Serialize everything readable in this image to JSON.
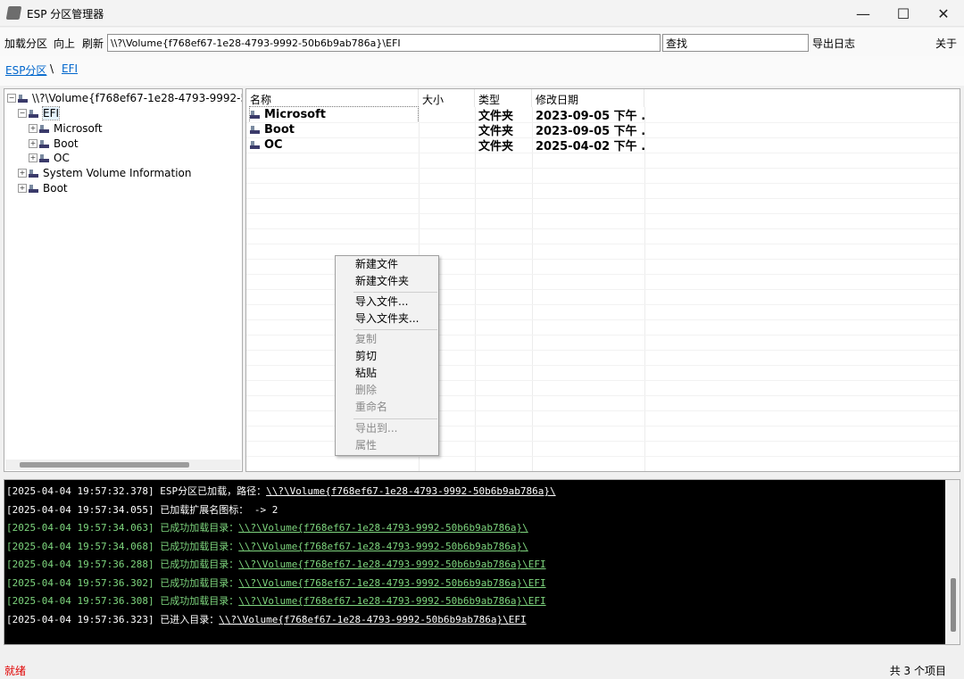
{
  "window": {
    "title": "ESP 分区管理器",
    "minimize": "—",
    "maximize": "☐",
    "close": "✕"
  },
  "toolbar": {
    "load": "加载分区",
    "up": "向上",
    "refresh": "刷新",
    "path": "\\\\?\\Volume{f768ef67-1e28-4793-9992-50b6b9ab786a}\\EFI",
    "search": "查找",
    "export_log": "导出日志",
    "about": "关于"
  },
  "breadcrumb": {
    "root": "ESP分区",
    "sep": "\\",
    "current": "EFI"
  },
  "tree": {
    "root": "\\\\?\\Volume{f768ef67-1e28-4793-9992-50b6b9ab786a}\\",
    "efi": "EFI",
    "microsoft": "Microsoft",
    "boot": "Boot",
    "oc": "OC",
    "svi": "System Volume Information",
    "boot2": "Boot"
  },
  "list": {
    "columns": [
      "名称",
      "大小",
      "类型",
      "修改日期"
    ],
    "rows": [
      {
        "name": "Microsoft",
        "size": "",
        "type": "文件夹",
        "date": "2023-09-05 下午 ..."
      },
      {
        "name": "Boot",
        "size": "",
        "type": "文件夹",
        "date": "2023-09-05 下午 ..."
      },
      {
        "name": "OC",
        "size": "",
        "type": "文件夹",
        "date": "2025-04-02 下午 ..."
      }
    ]
  },
  "context_menu": {
    "new_file": "新建文件",
    "new_folder": "新建文件夹",
    "import_file": "导入文件...",
    "import_folder": "导入文件夹...",
    "copy": "复制",
    "cut": "剪切",
    "paste": "粘贴",
    "delete": "删除",
    "rename": "重命名",
    "export_to": "导出到...",
    "properties": "属性"
  },
  "log": [
    {
      "ts": "[2025-04-04 19:57:32.378]",
      "msg": " ESP分区已加载，路径：",
      "path": "\\\\?\\Volume{f768ef67-1e28-4793-9992-50b6b9ab786a}\\",
      "color": "#ffffff"
    },
    {
      "ts": "[2025-04-04 19:57:34.055]",
      "msg": " 已加载扩展名图标：  -> 2",
      "path": "",
      "color": "#ffffff"
    },
    {
      "ts": "[2025-04-04 19:57:34.063]",
      "msg": " 已成功加载目录：",
      "path": "\\\\?\\Volume{f768ef67-1e28-4793-9992-50b6b9ab786a}\\",
      "color": "#7ed67e"
    },
    {
      "ts": "[2025-04-04 19:57:34.068]",
      "msg": " 已成功加载目录：",
      "path": "\\\\?\\Volume{f768ef67-1e28-4793-9992-50b6b9ab786a}\\",
      "color": "#7ed67e"
    },
    {
      "ts": "[2025-04-04 19:57:36.288]",
      "msg": " 已成功加载目录：",
      "path": "\\\\?\\Volume{f768ef67-1e28-4793-9992-50b6b9ab786a}\\EFI",
      "color": "#7ed67e"
    },
    {
      "ts": "[2025-04-04 19:57:36.302]",
      "msg": " 已成功加载目录：",
      "path": "\\\\?\\Volume{f768ef67-1e28-4793-9992-50b6b9ab786a}\\EFI",
      "color": "#7ed67e"
    },
    {
      "ts": "[2025-04-04 19:57:36.308]",
      "msg": " 已成功加载目录：",
      "path": "\\\\?\\Volume{f768ef67-1e28-4793-9992-50b6b9ab786a}\\EFI",
      "color": "#7ed67e"
    },
    {
      "ts": "[2025-04-04 19:57:36.323]",
      "msg": " 已进入目录：",
      "path": "\\\\?\\Volume{f768ef67-1e28-4793-9992-50b6b9ab786a}\\EFI",
      "color": "#ffffff"
    }
  ],
  "status": {
    "left": "就绪",
    "right": "共 3 个项目",
    "left_color": "#e00000"
  }
}
